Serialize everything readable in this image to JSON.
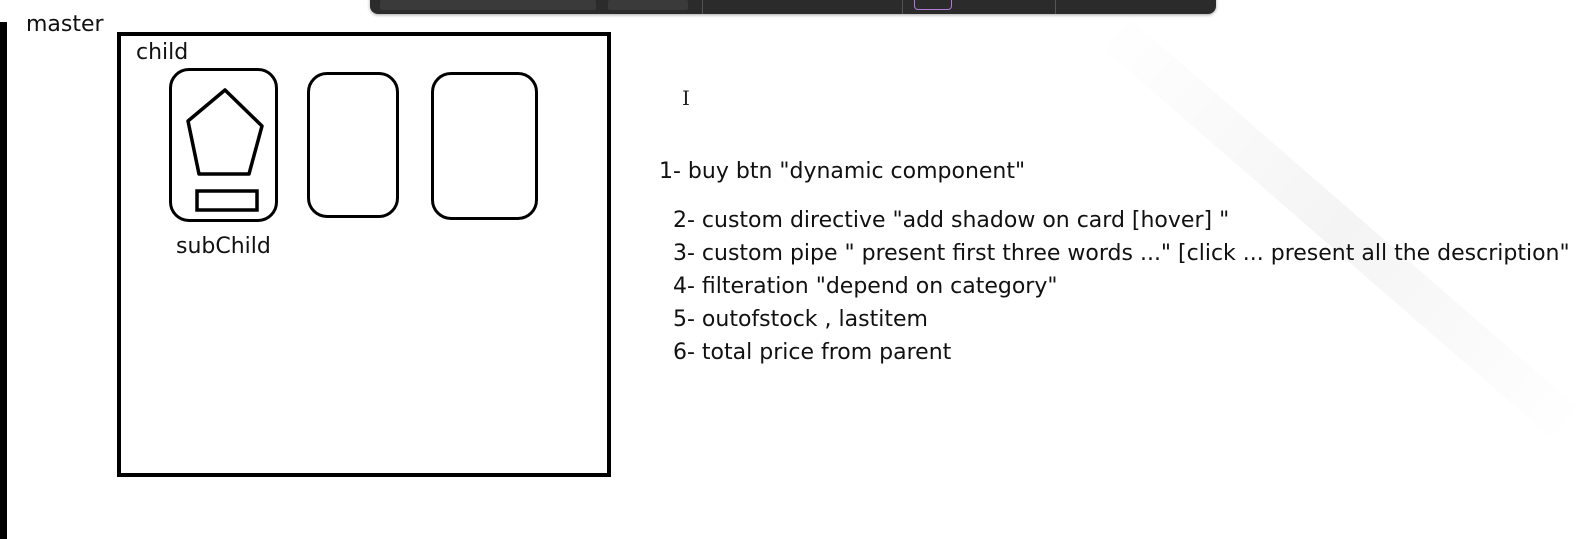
{
  "labels": {
    "master": "master",
    "child": "child",
    "subchild": "subChild"
  },
  "notes": [
    "1- buy btn \"dynamic component\"",
    "2- custom directive \"add shadow on card [hover] \"",
    "3- custom pipe \" present first three words ...\" [click ... present all the description\"",
    "4- filteration \"depend on category\"",
    "5- outofstock , lastitem",
    "6- total price from parent"
  ],
  "colors": {
    "stroke": "#000000",
    "background": "#ffffff",
    "toolbar": "#2b2b2b",
    "pen_accent": "#b07ad8"
  },
  "icons": {
    "product_image": "pentagon-icon",
    "buy_button": "rectangle-button-icon",
    "text_cursor": "i-beam-cursor-icon"
  }
}
